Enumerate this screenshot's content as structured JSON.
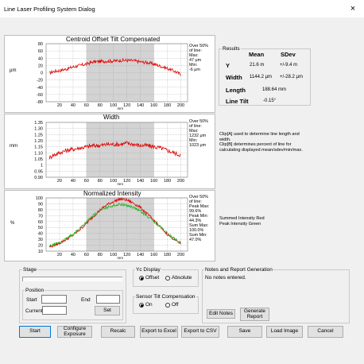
{
  "window": {
    "title": "Line Laser Profiling System Dialog",
    "close_glyph": "×"
  },
  "charts": [
    {
      "title": "Centroid Offset Tilt Compensated",
      "ylabel": "μm",
      "yticks": [
        "80",
        "60",
        "40",
        "20",
        "0",
        "-20",
        "-40",
        "-60",
        "-80"
      ],
      "side_text": [
        "Over 50%",
        "of line:",
        "Max:",
        "47 μm",
        "Min:",
        "-6 μm"
      ]
    },
    {
      "title": "Width",
      "ylabel": "mm",
      "yticks": [
        "1.35",
        "1.30",
        "1.25",
        "1.20",
        "1.15",
        "1.10",
        "1.05",
        "1",
        "0.95",
        "0.90"
      ],
      "side_text": [
        "Over 50%",
        "of line:",
        "Max:",
        "1232 μm",
        "Min:",
        "1023 μm"
      ]
    },
    {
      "title": "Normalized Intensity",
      "ylabel": "%",
      "yticks": [
        "100",
        "90",
        "80",
        "70",
        "60",
        "50",
        "40",
        "30",
        "20",
        "10"
      ],
      "side_text": [
        "Over 50%",
        "of line:",
        "Peak Max:",
        "99.6%",
        "Peak Min:",
        "44.3%",
        "Sum Max:",
        "100.0%",
        "Sum Min:",
        "47.0%"
      ]
    }
  ],
  "xticks": [
    "20",
    "40",
    "60",
    "80",
    "100",
    "120",
    "140",
    "160",
    "180",
    "200"
  ],
  "xunit": "mm",
  "chart_data": [
    {
      "type": "line",
      "title": "Centroid Offset Tilt Compensated",
      "xlabel": "mm",
      "ylabel": "μm",
      "xlim": [
        0,
        210
      ],
      "ylim": [
        -80,
        80
      ],
      "highlight_region": [
        60,
        160
      ],
      "grid": true,
      "series": [
        {
          "color": "#e00000",
          "x": [
            5,
            10,
            20,
            30,
            40,
            50,
            60,
            70,
            80,
            90,
            100,
            110,
            120,
            130,
            140,
            150,
            160,
            170,
            180,
            190,
            200
          ],
          "y": [
            -1,
            3,
            6,
            10,
            16,
            20,
            24,
            30,
            31,
            32,
            32,
            34,
            34,
            33,
            30,
            28,
            24,
            18,
            12,
            5,
            -5
          ]
        }
      ]
    },
    {
      "type": "line",
      "title": "Width",
      "xlabel": "mm",
      "ylabel": "mm",
      "xlim": [
        0,
        210
      ],
      "ylim": [
        0.9,
        1.35
      ],
      "highlight_region": [
        60,
        160
      ],
      "grid": true,
      "series": [
        {
          "color": "#e00000",
          "x": [
            5,
            10,
            20,
            30,
            40,
            50,
            60,
            70,
            80,
            90,
            100,
            110,
            120,
            130,
            140,
            150,
            160,
            170,
            180,
            190,
            200
          ],
          "y": [
            1.06,
            1.08,
            1.1,
            1.12,
            1.13,
            1.14,
            1.15,
            1.16,
            1.16,
            1.17,
            1.17,
            1.17,
            1.18,
            1.17,
            1.16,
            1.16,
            1.15,
            1.14,
            1.12,
            1.1,
            1.08
          ]
        }
      ]
    },
    {
      "type": "line",
      "title": "Normalized Intensity",
      "xlabel": "mm",
      "ylabel": "%",
      "xlim": [
        0,
        210
      ],
      "ylim": [
        0,
        100
      ],
      "highlight_region": [
        60,
        160
      ],
      "grid": true,
      "series": [
        {
          "name": "Summed Intensity Red",
          "color": "#e00000",
          "x": [
            5,
            10,
            20,
            30,
            40,
            50,
            60,
            70,
            80,
            90,
            100,
            110,
            120,
            130,
            140,
            150,
            160,
            170,
            180,
            190,
            200
          ],
          "y": [
            8,
            10,
            15,
            22,
            30,
            40,
            52,
            65,
            77,
            87,
            93,
            98,
            96,
            90,
            82,
            70,
            58,
            44,
            32,
            22,
            14
          ]
        },
        {
          "name": "Peak Intensity Green",
          "color": "#22b022",
          "x": [
            5,
            10,
            20,
            30,
            40,
            50,
            60,
            70,
            80,
            90,
            100,
            110,
            120,
            130,
            140,
            150,
            160,
            170,
            180,
            190,
            200
          ],
          "y": [
            9,
            11,
            16,
            23,
            32,
            43,
            55,
            67,
            76,
            82,
            86,
            88,
            86,
            82,
            75,
            66,
            56,
            45,
            33,
            24,
            15
          ]
        }
      ]
    }
  ],
  "results": {
    "heading": "Results",
    "col_mean": "Mean",
    "col_sdev": "SDev",
    "rows": [
      {
        "label": "Y",
        "mean": "21.6 m",
        "sdev": "+/-9.4 m"
      },
      {
        "label": "Width",
        "mean": "1144.2 μm",
        "sdev": "+/-28.2 μm"
      },
      {
        "label": "Length",
        "mean": "188.64 mm",
        "sdev": ""
      },
      {
        "label": "Line Tilt",
        "mean": "-0.15°",
        "sdev": ""
      }
    ]
  },
  "info_text": [
    "Clip[A] used to determine line length and",
    "width.",
    "Clip[B] determines percent of line for",
    "calculating displayed mean/sdev/min/max."
  ],
  "legend_text": [
    "Summed Intensity Red",
    "Peak Intensity Green"
  ],
  "stage": {
    "label": "Stage"
  },
  "position": {
    "label": "Position",
    "start_label": "Start",
    "end_label": "End",
    "current_label": "Current",
    "set_label": "Set"
  },
  "yc_display": {
    "label": "Yc Display",
    "offset": "Offset",
    "absolute": "Absolute",
    "selected": "Offset"
  },
  "sensor_tilt": {
    "label": "Sensor Tilt Compensation",
    "on": "On",
    "off": "Off",
    "selected": "On"
  },
  "notes": {
    "label": "Notes and Report Generation",
    "text": "No notes entered.",
    "edit_label": "Edit Notes",
    "generate_label": "Generate Report"
  },
  "buttons": {
    "start": "Start",
    "configure": "Configure Exposure",
    "recalc": "Recalc",
    "export_excel": "Export to Excel",
    "export_csv": "Export to CSV",
    "save": "Save",
    "load_image": "Load Image",
    "cancel": "Cancel"
  }
}
